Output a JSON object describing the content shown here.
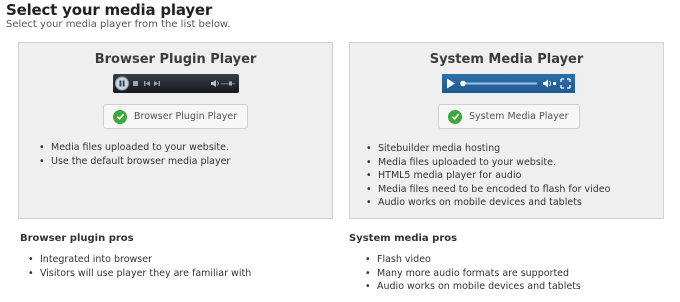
{
  "header": {
    "title": "Select your media player",
    "subtitle": "Select your media player from the list below."
  },
  "panels": [
    {
      "title": "Browser Plugin Player",
      "button_label": "Browser Plugin Player",
      "features": [
        "Media files uploaded to your website.",
        "Use the default browser media player"
      ]
    },
    {
      "title": "System Media Player",
      "button_label": "System Media Player",
      "features": [
        "Sitebuilder media hosting",
        "Media files uploaded to your website.",
        "HTML5 media player for audio",
        "Media files need to be encoded to flash for video",
        "Audio works on mobile devices and tablets"
      ]
    }
  ],
  "pros": [
    {
      "heading": "Browser plugin pros",
      "items": [
        "Integrated into browser",
        "Visitors will use player they are familiar with"
      ]
    },
    {
      "heading": "System media pros",
      "items": [
        "Flash video",
        "Many more audio formats are supported",
        "Audio works on mobile devices and tablets"
      ]
    }
  ],
  "colors": {
    "check_green": "#3da83f",
    "system_player_blue": "#2666a0",
    "plugin_player_dark": "#1d2126",
    "panel_background": "#efefef"
  },
  "icons": [
    "play-icon",
    "pause-icon",
    "stop-icon",
    "previous-icon",
    "next-icon",
    "volume-icon",
    "fullscreen-icon",
    "check-icon"
  ]
}
